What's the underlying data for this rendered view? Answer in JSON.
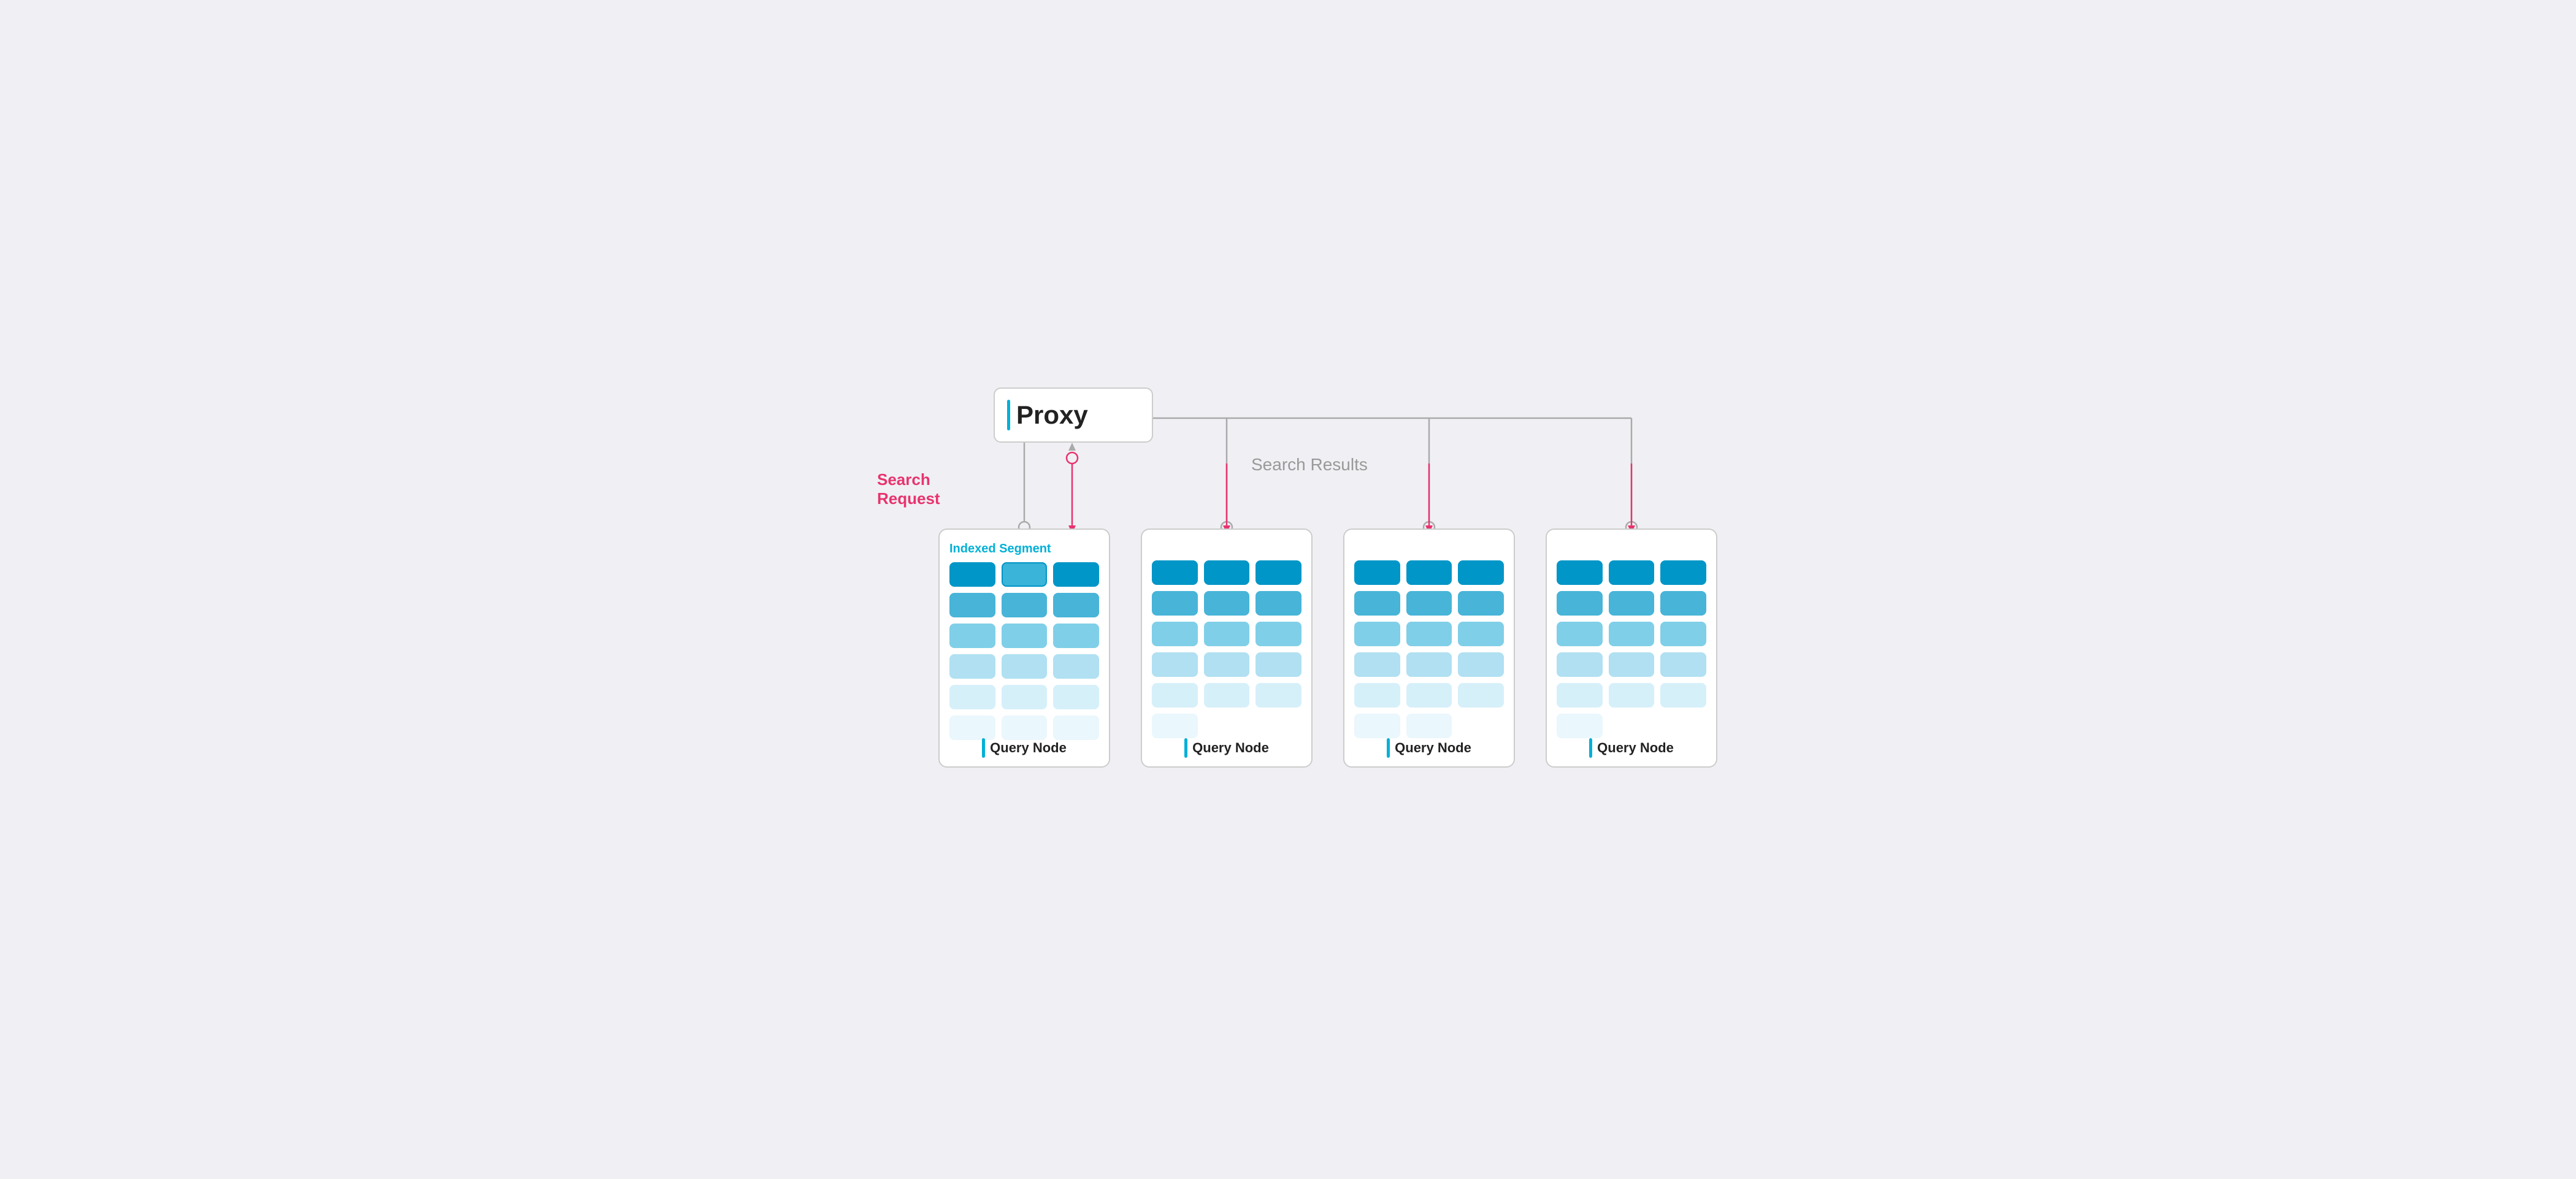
{
  "diagram": {
    "proxy": {
      "label": "Proxy",
      "bar_color": "#00b0d7"
    },
    "labels": {
      "search_request": "Search\nRequest",
      "search_results": "Search Results"
    },
    "nodes": [
      {
        "id": "node-1",
        "label": "Query Node",
        "has_segment_label": true,
        "segment_label": "Indexed Segment",
        "highlighted_cell": 1
      },
      {
        "id": "node-2",
        "label": "Query Node",
        "has_segment_label": false
      },
      {
        "id": "node-3",
        "label": "Query Node",
        "has_segment_label": false
      },
      {
        "id": "node-4",
        "label": "Query Node",
        "has_segment_label": false
      }
    ],
    "colors": {
      "accent_blue": "#00b0d7",
      "accent_red": "#e8336e",
      "label_gray": "#999999",
      "node_border": "#cccccc",
      "background": "#f0f0f4"
    }
  }
}
